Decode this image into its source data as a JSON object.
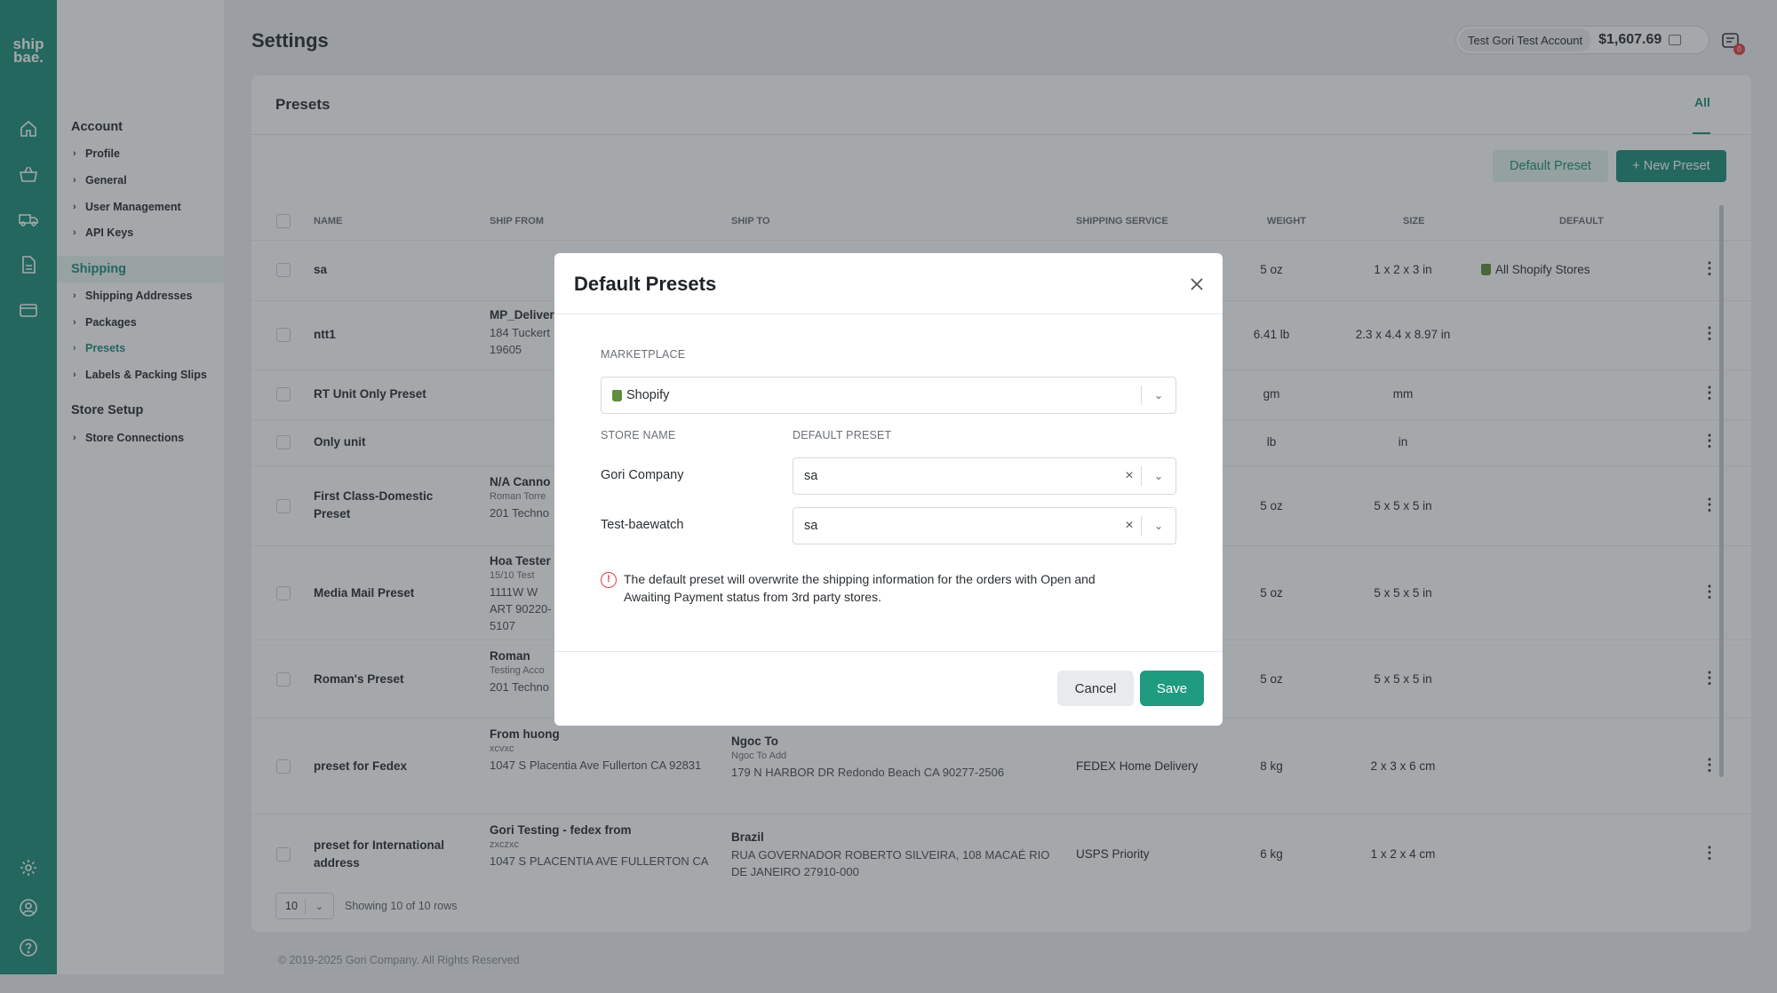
{
  "brand": {
    "logo_text": "ship bae."
  },
  "rail_icons": [
    "home-icon",
    "basket-icon",
    "truck-icon",
    "document-icon",
    "card-icon",
    "gear-icon",
    "user-circle-icon",
    "help-icon"
  ],
  "sidebar": {
    "account": {
      "label": "Account",
      "items": [
        "Profile",
        "General",
        "User Management",
        "API Keys"
      ]
    },
    "shipping": {
      "label": "Shipping",
      "items": [
        "Shipping Addresses",
        "Packages",
        "Presets",
        "Labels & Packing Slips"
      ]
    },
    "store_setup": {
      "label": "Store Setup",
      "items": [
        "Store Connections"
      ]
    }
  },
  "header": {
    "title": "Settings",
    "account_name": "Test Gori Test Account",
    "balance": "$1,607.69",
    "notification_count": "0"
  },
  "presets": {
    "title": "Presets",
    "tab_all": "All",
    "default_preset_button": "Default Preset",
    "new_preset_button": "+ New Preset",
    "columns": [
      "NAME",
      "SHIP FROM",
      "SHIP TO",
      "SHIPPING SERVICE",
      "WEIGHT",
      "SIZE",
      "DEFAULT"
    ],
    "rows": [
      {
        "name": "sa",
        "from_name": "",
        "from_sub": "",
        "from_addr": "",
        "to_name": "",
        "to_sub": "",
        "to_addr": "",
        "service": "",
        "weight": "5 oz",
        "size": "1 x 2 x 3 in",
        "default": "All Shopify Stores"
      },
      {
        "name": "ntt1",
        "from_name": "MP_Deliver",
        "from_sub": "",
        "from_addr": "184 Tuckert 19605",
        "to_name": "",
        "to_sub": "",
        "to_addr": "",
        "service": "",
        "weight": "6.41 lb",
        "size": "2.3 x 4.4 x 8.97 in",
        "default": ""
      },
      {
        "name": "RT Unit Only Preset",
        "from_name": "",
        "from_sub": "",
        "from_addr": "",
        "to_name": "",
        "to_sub": "",
        "to_addr": "",
        "service": "",
        "weight": "gm",
        "size": "mm",
        "default": ""
      },
      {
        "name": "Only unit",
        "from_name": "",
        "from_sub": "",
        "from_addr": "",
        "to_name": "",
        "to_sub": "",
        "to_addr": "",
        "service": "",
        "weight": "lb",
        "size": "in",
        "default": ""
      },
      {
        "name": "First Class-Domestic Preset",
        "from_name": "N/A Canno",
        "from_sub": "Roman Torre",
        "from_addr": "201 Techno",
        "to_name": "",
        "to_sub": "",
        "to_addr": "",
        "service": "",
        "weight": "5 oz",
        "size": "5 x 5 x 5 in",
        "default": ""
      },
      {
        "name": "Media Mail Preset",
        "from_name": "Hoa Tester",
        "from_sub": "15/10 Test",
        "from_addr": "1111W W ART 90220-5107",
        "to_name": "",
        "to_sub": "",
        "to_addr": "",
        "service": "",
        "weight": "5 oz",
        "size": "5 x 5 x 5 in",
        "default": ""
      },
      {
        "name": "Roman's Preset",
        "from_name": "Roman",
        "from_sub": "Testing Acco",
        "from_addr": "201 Techno",
        "to_name": "",
        "to_sub": "",
        "to_addr": "",
        "service": "",
        "weight": "5 oz",
        "size": "5 x 5 x 5 in",
        "default": ""
      },
      {
        "name": "preset for Fedex",
        "from_name": "From huong",
        "from_sub": "xcvxc",
        "from_addr": "1047 S Placentia Ave Fullerton CA 92831",
        "to_name": "Ngoc To",
        "to_sub": "Ngoc To Add",
        "to_addr": "179 N HARBOR DR Redondo Beach CA 90277-2506",
        "service": "FEDEX Home Delivery",
        "weight": "8 kg",
        "size": "2 x 3 x 6 cm",
        "default": ""
      },
      {
        "name": "preset for International address",
        "from_name": "Gori Testing - fedex from",
        "from_sub": "zxczxc",
        "from_addr": "1047 S PLACENTIA AVE FULLERTON CA",
        "to_name": "Brazil",
        "to_sub": "",
        "to_addr": "RUA GOVERNADOR ROBERTO SILVEIRA, 108 MACAÉ RIO DE JANEIRO 27910-000",
        "service": "USPS Priority",
        "weight": "6 kg",
        "size": "1 x 2 x 4 cm",
        "default": ""
      }
    ],
    "page_size": "10",
    "rows_text": "Showing 10 of 10 rows"
  },
  "footer": {
    "text": "© 2019-2025 Gori Company. All Rights Reserved"
  },
  "modal": {
    "title": "Default Presets",
    "marketplace_label": "MARKETPLACE",
    "marketplace_value": "Shopify",
    "store_name_header": "STORE NAME",
    "default_preset_header": "DEFAULT PRESET",
    "stores": [
      {
        "name": "Gori Company",
        "preset": "sa"
      },
      {
        "name": "Test-baewatch",
        "preset": "sa"
      }
    ],
    "warning": "The default preset will overwrite the shipping information for the orders with Open and Awaiting Payment status from 3rd party stores.",
    "cancel_label": "Cancel",
    "save_label": "Save"
  },
  "colors": {
    "brand": "#1f8f7a",
    "shopify": "#5e8e3e",
    "danger": "#d9414a"
  }
}
